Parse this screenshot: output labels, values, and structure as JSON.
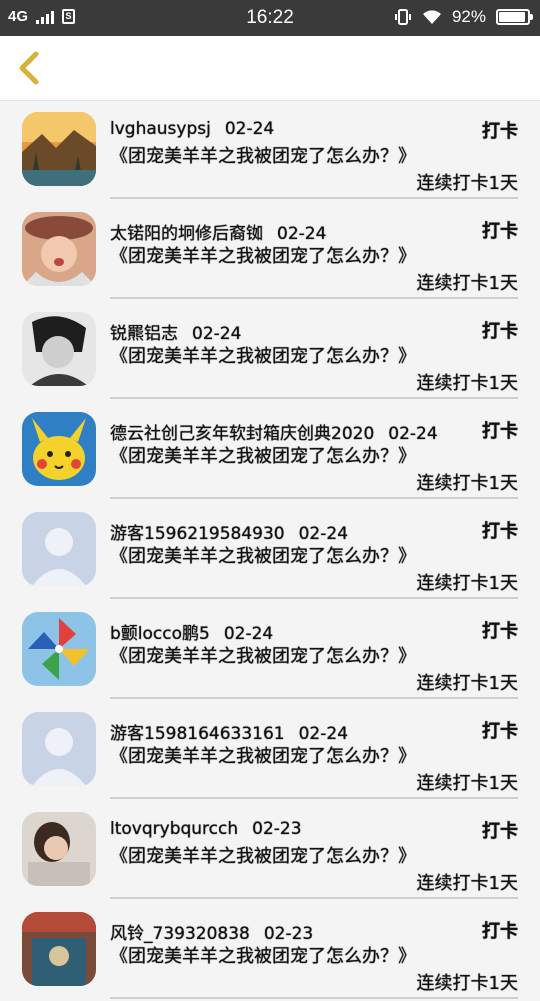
{
  "status_bar": {
    "network": "4G",
    "sim_label": "S",
    "time": "16:22",
    "battery": "92%",
    "battery_level": 0.92
  },
  "nav": {
    "back_icon": "chevron-left-icon",
    "accent_color": "#d9b13a"
  },
  "list": {
    "items": [
      {
        "username": "lvghausypsj",
        "date": "02-24",
        "action": "打卡",
        "book": "《团宠美羊羊之我被团宠了怎么办？》",
        "streak": "连续打卡1天",
        "avatar": "landscape"
      },
      {
        "username": "太锘阳的坰修后裔铷",
        "date": "02-24",
        "action": "打卡",
        "book": "《团宠美羊羊之我被团宠了怎么办？》",
        "streak": "连续打卡1天",
        "avatar": "girl-hat"
      },
      {
        "username": "锐羆铝志",
        "date": "02-24",
        "action": "打卡",
        "book": "《团宠美羊羊之我被团宠了怎么办？》",
        "streak": "连续打卡1天",
        "avatar": "bw-portrait"
      },
      {
        "username": "德云社创己亥年软封箱庆创典2020",
        "date": "02-24",
        "action": "打卡",
        "book": "《团宠美羊羊之我被团宠了怎么办？》",
        "streak": "连续打卡1天",
        "avatar": "pikachu"
      },
      {
        "username": "游客1596219584930",
        "date": "02-24",
        "action": "打卡",
        "book": "《团宠美羊羊之我被团宠了怎么办？》",
        "streak": "连续打卡1天",
        "avatar": "default"
      },
      {
        "username": "b颤locco鹏5",
        "date": "02-24",
        "action": "打卡",
        "book": "《团宠美羊羊之我被团宠了怎么办？》",
        "streak": "连续打卡1天",
        "avatar": "pinwheel"
      },
      {
        "username": "游客1598164633161",
        "date": "02-24",
        "action": "打卡",
        "book": "《团宠美羊羊之我被团宠了怎么办？》",
        "streak": "连续打卡1天",
        "avatar": "default"
      },
      {
        "username": "ltovqrybqurcch",
        "date": "02-23",
        "action": "打卡",
        "book": "《团宠美羊羊之我被团宠了怎么办？》",
        "streak": "连续打卡1天",
        "avatar": "girl-sleep"
      },
      {
        "username": "风铃_739320838",
        "date": "02-23",
        "action": "打卡",
        "book": "《团宠美羊羊之我被团宠了怎么办？》",
        "streak": "连续打卡1天",
        "avatar": "shop"
      }
    ]
  }
}
